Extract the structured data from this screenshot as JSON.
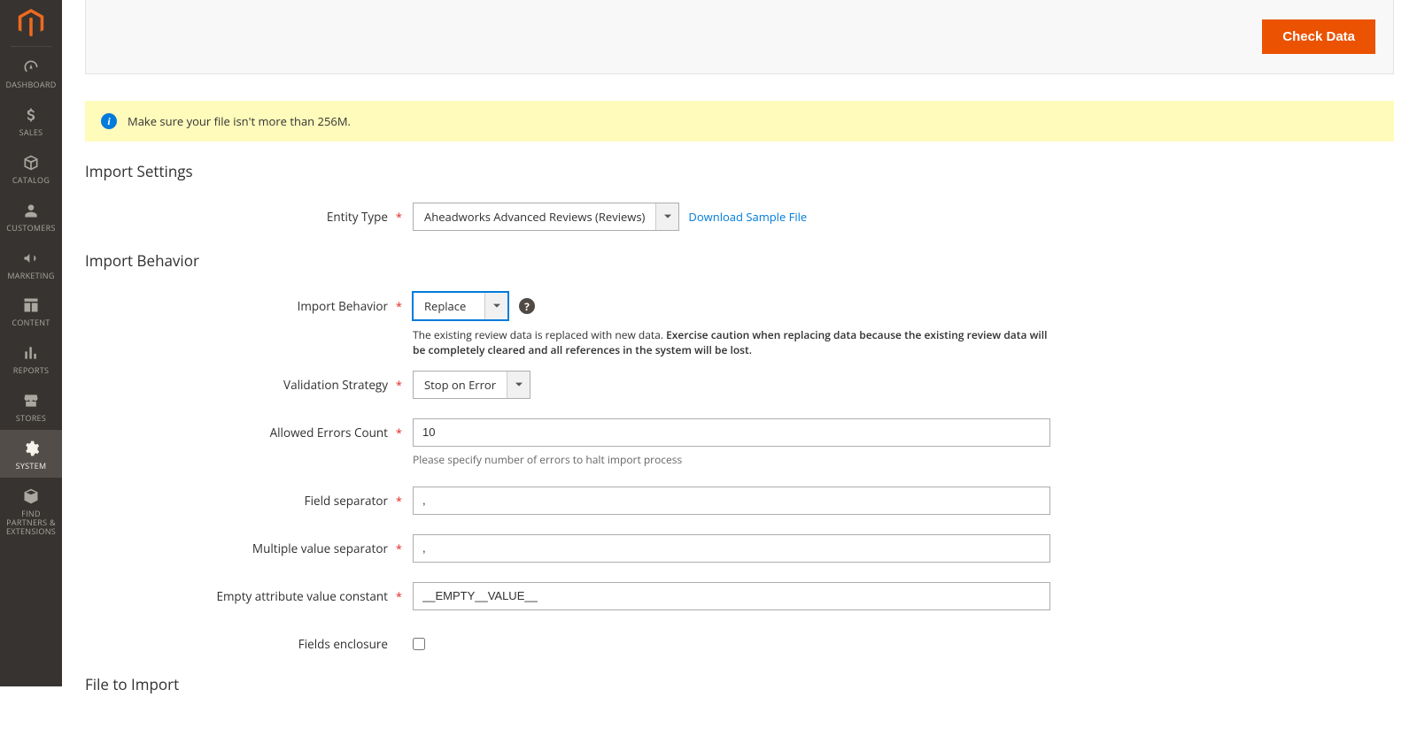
{
  "sidebar": {
    "items": [
      {
        "label": "DASHBOARD",
        "name": "sidebar-item-dashboard"
      },
      {
        "label": "SALES",
        "name": "sidebar-item-sales"
      },
      {
        "label": "CATALOG",
        "name": "sidebar-item-catalog"
      },
      {
        "label": "CUSTOMERS",
        "name": "sidebar-item-customers"
      },
      {
        "label": "MARKETING",
        "name": "sidebar-item-marketing"
      },
      {
        "label": "CONTENT",
        "name": "sidebar-item-content"
      },
      {
        "label": "REPORTS",
        "name": "sidebar-item-reports"
      },
      {
        "label": "STORES",
        "name": "sidebar-item-stores"
      },
      {
        "label": "SYSTEM",
        "name": "sidebar-item-system"
      },
      {
        "label": "FIND PARTNERS & EXTENSIONS",
        "name": "sidebar-item-partners"
      }
    ]
  },
  "actions": {
    "check_data": "Check Data"
  },
  "message": {
    "info": "Make sure your file isn't more than 256M."
  },
  "sections": {
    "import_settings": "Import Settings",
    "import_behavior": "Import Behavior",
    "file_to_import": "File to Import"
  },
  "fields": {
    "entity_type": {
      "label": "Entity Type",
      "value": "Aheadworks Advanced Reviews (Reviews)",
      "download_link": "Download Sample File"
    },
    "import_behavior": {
      "label": "Import Behavior",
      "value": "Replace",
      "note_normal": "The existing review data is replaced with new data. ",
      "note_bold": "Exercise caution when replacing data because the existing review data will be completely cleared and all references in the system will be lost."
    },
    "validation_strategy": {
      "label": "Validation Strategy",
      "value": "Stop on Error"
    },
    "allowed_errors": {
      "label": "Allowed Errors Count",
      "value": "10",
      "hint": "Please specify number of errors to halt import process"
    },
    "field_separator": {
      "label": "Field separator",
      "value": ","
    },
    "multi_separator": {
      "label": "Multiple value separator",
      "value": ","
    },
    "empty_constant": {
      "label": "Empty attribute value constant",
      "value": "__EMPTY__VALUE__"
    },
    "fields_enclosure": {
      "label": "Fields enclosure",
      "checked": false
    }
  }
}
